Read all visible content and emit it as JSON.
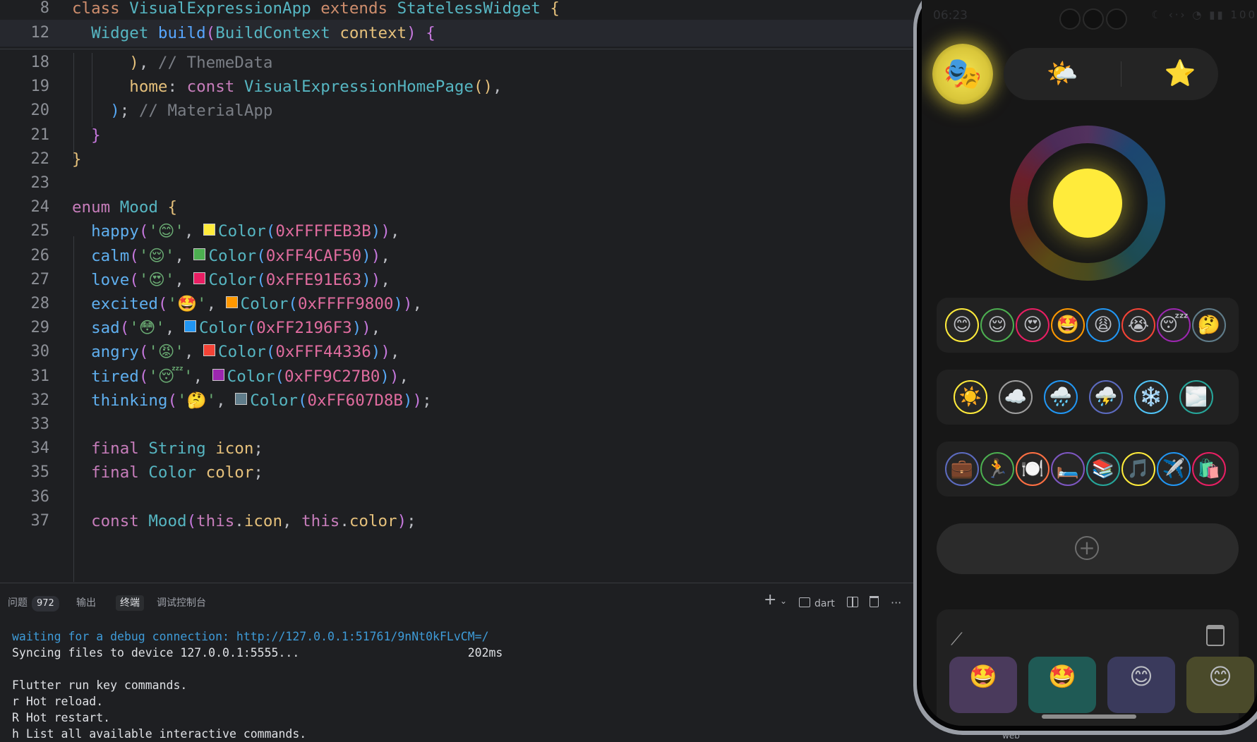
{
  "editor": {
    "sticky": [
      {
        "num": "8",
        "html": "<span class=\"k\">class</span> <span class=\"cl\">VisualExpressionApp</span> <span class=\"k\">extends</span> <span class=\"cl\">StatelessWidget</span> <span class=\"p1\">{</span>"
      },
      {
        "num": "12",
        "html": "  <span class=\"cl\">Widget</span> <span class=\"f\">build</span><span class=\"p2\">(</span><span class=\"cl\">BuildContext</span> <span class=\"id\">context</span><span class=\"p2\">)</span> <span class=\"p2\">{</span>"
      }
    ],
    "lines": [
      {
        "num": "18",
        "html": "      <span class=\"p1\">)</span>, <span class=\"c\">// ThemeData</span>"
      },
      {
        "num": "19",
        "html": "      <span class=\"fld\">home</span>: <span class=\"kw\">const</span> <span class=\"cl\">VisualExpressionHomePage</span><span class=\"p1\">()</span>,"
      },
      {
        "num": "20",
        "html": "    <span class=\"p3\">)</span>; <span class=\"c\">// MaterialApp</span>"
      },
      {
        "num": "21",
        "html": "  <span class=\"p2\">}</span>"
      },
      {
        "num": "22",
        "html": "<span class=\"p1\">}</span>"
      },
      {
        "num": "23",
        "html": ""
      },
      {
        "num": "24",
        "html": "<span class=\"kw\">enum</span> <span class=\"cl\">Mood</span> <span class=\"p1\">{</span>"
      },
      {
        "num": "25",
        "html": "  <span class=\"mood\">happy</span><span class=\"p2\">(</span><span class=\"s\">'<span class=\"emoji\">😊</span>'</span>, <span class=\"swatch\" style=\"background:#FFEB3B\"></span><span class=\"cl\">Color</span><span class=\"p3\">(</span><span class=\"n\">0xFFFFEB3B</span><span class=\"p3\">)</span><span class=\"p2\">)</span>,"
      },
      {
        "num": "26",
        "html": "  <span class=\"mood\">calm</span><span class=\"p2\">(</span><span class=\"s\">'<span class=\"emoji\">😌</span>'</span>, <span class=\"swatch\" style=\"background:#4CAF50\"></span><span class=\"cl\">Color</span><span class=\"p3\">(</span><span class=\"n\">0xFF4CAF50</span><span class=\"p3\">)</span><span class=\"p2\">)</span>,"
      },
      {
        "num": "27",
        "html": "  <span class=\"mood\">love</span><span class=\"p2\">(</span><span class=\"s\">'<span class=\"emoji\">😍</span>'</span>, <span class=\"swatch\" style=\"background:#E91E63\"></span><span class=\"cl\">Color</span><span class=\"p3\">(</span><span class=\"n\">0xFFE91E63</span><span class=\"p3\">)</span><span class=\"p2\">)</span>,"
      },
      {
        "num": "28",
        "html": "  <span class=\"mood\">excited</span><span class=\"p2\">(</span><span class=\"s\">'<span class=\"emoji\">🤩</span>'</span>, <span class=\"swatch\" style=\"background:#FF9800\"></span><span class=\"cl\">Color</span><span class=\"p3\">(</span><span class=\"n\">0xFFFF9800</span><span class=\"p3\">)</span><span class=\"p2\">)</span>,"
      },
      {
        "num": "29",
        "html": "  <span class=\"mood\">sad</span><span class=\"p2\">(</span><span class=\"s\">'<span class=\"emoji\">😳</span>'</span>, <span class=\"swatch\" style=\"background:#2196F3\"></span><span class=\"cl\">Color</span><span class=\"p3\">(</span><span class=\"n\">0xFF2196F3</span><span class=\"p3\">)</span><span class=\"p2\">)</span>,"
      },
      {
        "num": "30",
        "html": "  <span class=\"mood\">angry</span><span class=\"p2\">(</span><span class=\"s\">'<span class=\"emoji\">😡</span>'</span>, <span class=\"swatch\" style=\"background:#F44336\"></span><span class=\"cl\">Color</span><span class=\"p3\">(</span><span class=\"n\">0xFFF44336</span><span class=\"p3\">)</span><span class=\"p2\">)</span>,"
      },
      {
        "num": "31",
        "html": "  <span class=\"mood\">tired</span><span class=\"p2\">(</span><span class=\"s\">'<span class=\"emoji\">😴</span>'</span>, <span class=\"swatch\" style=\"background:#9C27B0\"></span><span class=\"cl\">Color</span><span class=\"p3\">(</span><span class=\"n\">0xFF9C27B0</span><span class=\"p3\">)</span><span class=\"p2\">)</span>,"
      },
      {
        "num": "32",
        "html": "  <span class=\"mood\">thinking</span><span class=\"p2\">(</span><span class=\"s\">'<span class=\"emoji\">🤔</span>'</span>, <span class=\"swatch\" style=\"background:#607D8B\"></span><span class=\"cl\">Color</span><span class=\"p3\">(</span><span class=\"n\">0xFF607D8B</span><span class=\"p3\">)</span><span class=\"p2\">)</span>;"
      },
      {
        "num": "33",
        "html": ""
      },
      {
        "num": "34",
        "html": "  <span class=\"kw\">final</span> <span class=\"cl\">String</span> <span class=\"fld\">icon</span>;"
      },
      {
        "num": "35",
        "html": "  <span class=\"kw\">final</span> <span class=\"cl\">Color</span> <span class=\"fld\">color</span>;"
      },
      {
        "num": "36",
        "html": ""
      },
      {
        "num": "37",
        "html": "  <span class=\"kw\">const</span> <span class=\"cl\">Mood</span><span class=\"p2\">(</span><span class=\"kw\">this</span>.<span class=\"fld\">icon</span>, <span class=\"kw\">this</span>.<span class=\"fld\">color</span><span class=\"p2\">)</span>;"
      }
    ]
  },
  "panel": {
    "tabs": {
      "problems": "问题",
      "problems_count": "972",
      "output": "输出",
      "terminal": "终端",
      "debug_console": "调试控制台"
    },
    "toolbar": {
      "add": "+",
      "add_chevron": "⌄",
      "shell_label": "dart",
      "more": "···"
    },
    "terminal_lines": [
      {
        "text": "waiting for a debug connection: http://127.0.0.1:51761/9nNt0kFLvCM=/",
        "link": true
      },
      {
        "text": "Syncing files to device 127.0.0.1:5555...                        202ms",
        "link": false
      },
      {
        "text": "",
        "link": false
      },
      {
        "text": "Flutter run key commands.",
        "link": false
      },
      {
        "text": "r Hot reload.",
        "link": false
      },
      {
        "text": "R Hot restart.",
        "link": false
      },
      {
        "text": "h List all available interactive commands.",
        "link": false
      }
    ],
    "below_phone_text": "web"
  },
  "phone": {
    "status_time": "06:23",
    "status_icons": "☾ ‹·› ◔ ▮▮ 100",
    "mode_icons": {
      "mask": "🎭",
      "weather": "🌤️",
      "star": "⭐"
    },
    "colors": {
      "sun": "#FFEB3B",
      "mask_glow": "#F5E552",
      "background": "#171717",
      "card": "#212121"
    },
    "mood_chips": [
      {
        "icon": "😊",
        "color": "#FFEB3B"
      },
      {
        "icon": "😌",
        "color": "#4CAF50"
      },
      {
        "icon": "😍",
        "color": "#E91E63"
      },
      {
        "icon": "🤩",
        "color": "#FF9800"
      },
      {
        "icon": "😩",
        "color": "#2196F3"
      },
      {
        "icon": "😭",
        "color": "#F44336"
      },
      {
        "icon": "😴",
        "color": "#9C27B0"
      },
      {
        "icon": "🤔",
        "color": "#607D8B"
      }
    ],
    "weather_chips": [
      {
        "icon": "☀️",
        "color": "#FFEB3B"
      },
      {
        "icon": "☁️",
        "color": "#9E9E9E"
      },
      {
        "icon": "🌧️",
        "color": "#2196F3"
      },
      {
        "icon": "⛈️",
        "color": "#5C6BC0"
      },
      {
        "icon": "❄️",
        "color": "#4FC3F7"
      },
      {
        "icon": "🌫️",
        "color": "#26A69A"
      }
    ],
    "activity_chips": [
      {
        "icon": "💼",
        "color": "#5C6BC0"
      },
      {
        "icon": "🏃",
        "color": "#4CAF50"
      },
      {
        "icon": "🍽️",
        "color": "#FF7043"
      },
      {
        "icon": "🛏️",
        "color": "#7E57C2"
      },
      {
        "icon": "📚",
        "color": "#26A69A"
      },
      {
        "icon": "🎵",
        "color": "#FFEB3B"
      },
      {
        "icon": "✈️",
        "color": "#2196F3"
      },
      {
        "icon": "🛍️",
        "color": "#E91E63"
      }
    ],
    "add_icon": "+",
    "trend_icon": "⟋",
    "entries": [
      {
        "icon": "🤩",
        "bg": "#4a3a5c"
      },
      {
        "icon": "🤩",
        "bg": "#1f5a55"
      },
      {
        "icon": "😊",
        "bg": "#3a3a5c"
      },
      {
        "icon": "😊",
        "bg": "#4a4a2a"
      }
    ]
  }
}
